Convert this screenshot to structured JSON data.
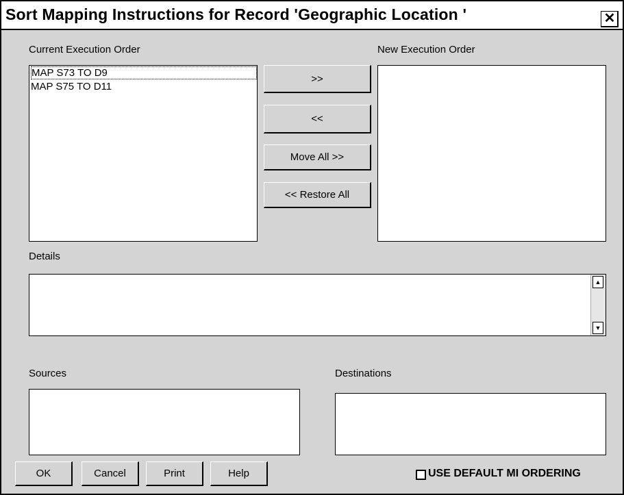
{
  "window": {
    "title": "Sort Mapping Instructions for Record 'Geographic Location          '",
    "close_label": "✕"
  },
  "current_order": {
    "label": "Current Execution Order",
    "items": [
      "MAP S73 TO D9",
      "MAP S75 TO D11"
    ]
  },
  "new_order": {
    "label": "New Execution Order",
    "items": []
  },
  "move_buttons": {
    "move_right": ">>",
    "move_left": "<<",
    "move_all": "Move All >>",
    "restore_all": "<< Restore All"
  },
  "details": {
    "label": "Details",
    "value": ""
  },
  "sources": {
    "label": "Sources",
    "value": ""
  },
  "destinations": {
    "label": "Destinations",
    "value": ""
  },
  "footer": {
    "ok": "OK",
    "cancel": "Cancel",
    "print": "Print",
    "help": "Help",
    "use_default_label": "USE DEFAULT MI ORDERING",
    "use_default_checked": false
  },
  "icons": {
    "scroll_up": "▲",
    "scroll_down": "▼"
  }
}
